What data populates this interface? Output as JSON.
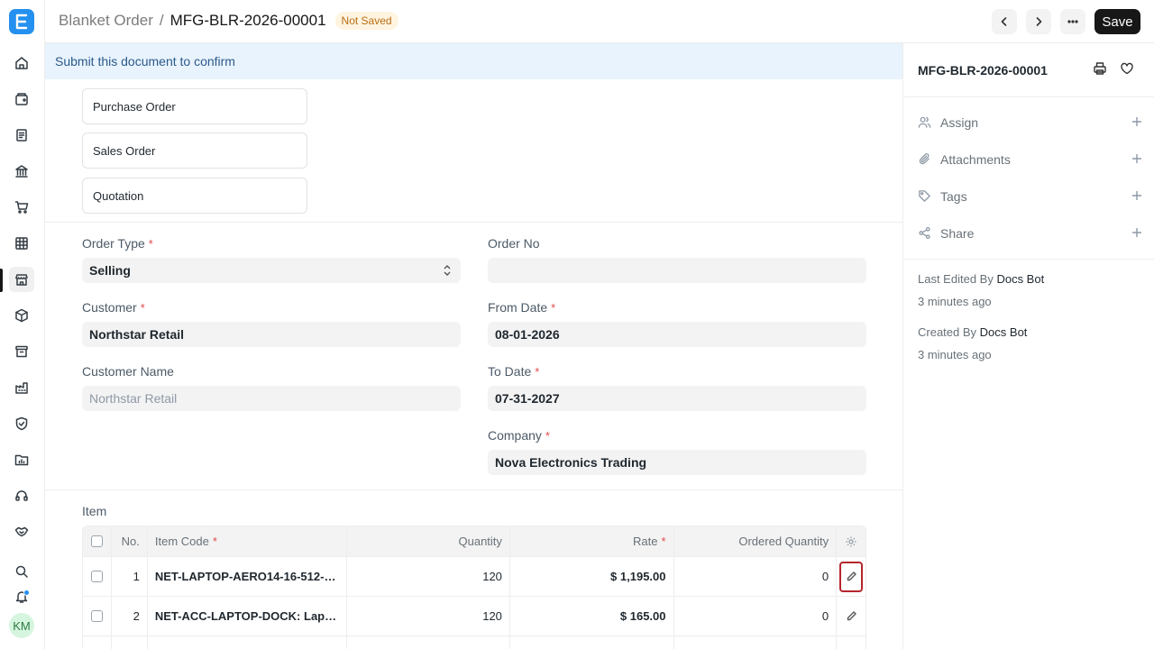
{
  "app": {
    "logo_letter": "E"
  },
  "user": {
    "initials": "KM"
  },
  "header": {
    "breadcrumb_parent": "Blanket Order",
    "breadcrumb_sep": "/",
    "doc_name": "MFG-BLR-2026-00001",
    "status_badge": "Not Saved",
    "save_label": "Save"
  },
  "banner": {
    "text": "Submit this document to confirm"
  },
  "links": [
    "Purchase Order",
    "Sales Order",
    "Quotation"
  ],
  "form": {
    "order_type": {
      "label": "Order Type",
      "required": "*",
      "value": "Selling"
    },
    "order_no": {
      "label": "Order No",
      "value": ""
    },
    "customer": {
      "label": "Customer",
      "required": "*",
      "value": "Northstar Retail"
    },
    "from_date": {
      "label": "From Date",
      "required": "*",
      "value": "08-01-2026"
    },
    "customer_name": {
      "label": "Customer Name",
      "value": "Northstar Retail"
    },
    "to_date": {
      "label": "To Date",
      "required": "*",
      "value": "07-31-2027"
    },
    "company": {
      "label": "Company",
      "required": "*",
      "value": "Nova Electronics Trading"
    }
  },
  "items": {
    "section_title": "Item",
    "columns": {
      "no": "No.",
      "item_code": "Item Code",
      "item_code_req": "*",
      "quantity": "Quantity",
      "rate": "Rate",
      "rate_req": "*",
      "ordered_quantity": "Ordered Quantity"
    },
    "rows": [
      {
        "no": "1",
        "item_code": "NET-LAPTOP-AERO14-16-512-…",
        "quantity": "120",
        "rate": "$ 1,195.00",
        "ordered_quantity": "0"
      },
      {
        "no": "2",
        "item_code": "NET-ACC-LAPTOP-DOCK: Lap…",
        "quantity": "120",
        "rate": "$ 165.00",
        "ordered_quantity": "0"
      }
    ]
  },
  "sidebar_right": {
    "doc_name": "MFG-BLR-2026-00001",
    "actions": [
      "Assign",
      "Attachments",
      "Tags",
      "Share"
    ],
    "last_edited_label": "Last Edited By",
    "last_edited_by": "Docs Bot",
    "last_edited_time": "3 minutes ago",
    "created_label": "Created By",
    "created_by": "Docs Bot",
    "created_time": "3 minutes ago"
  },
  "colors": {
    "accent": "#2490ef",
    "save_bg": "#171717",
    "required": "#e24c4c",
    "highlight": "#b5262e"
  }
}
